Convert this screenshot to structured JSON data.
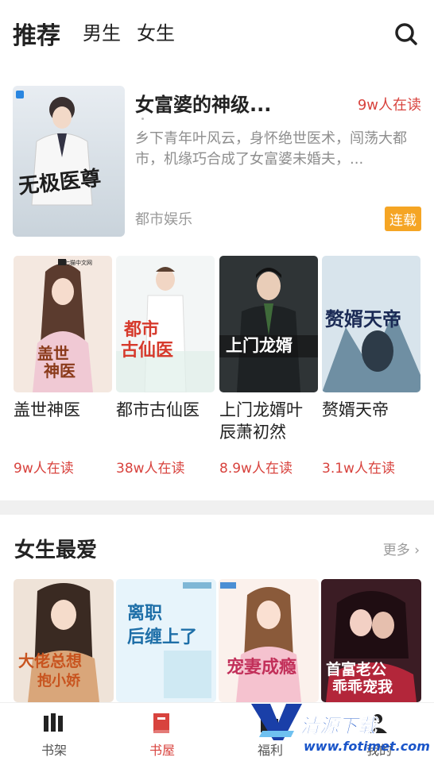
{
  "tabs": [
    {
      "label": "推荐",
      "active": true
    },
    {
      "label": "男生",
      "active": false
    },
    {
      "label": "女生",
      "active": false
    }
  ],
  "featured": {
    "title": "女富婆的神级...",
    "readers": "9w人在读",
    "description": "乡下青年叶风云，身怀绝世医术，闯荡大都市，机缘巧合成了女富婆未婚夫，...",
    "category": "都市娱乐",
    "status": "连载",
    "cover_text": "无极医尊"
  },
  "books": [
    {
      "title": "盖世神医",
      "readers": "9w人在读",
      "cover_text": "盖世神医",
      "publisher": "七猫中文网"
    },
    {
      "title": "都市古仙医",
      "readers": "38w人在读",
      "cover_text": "都市古仙医"
    },
    {
      "title": "上门龙婿叶辰萧初然",
      "readers": "8.9w人在读",
      "cover_text": "上门龙婿"
    },
    {
      "title": "赘婿天帝",
      "readers": "3.1w人在读",
      "cover_text": "赘婿天帝"
    }
  ],
  "section": {
    "title": "女生最爱",
    "more": "更多"
  },
  "girl_books": [
    {
      "cover_text": "大佬总想抱小娇"
    },
    {
      "cover_text": "离职后缠上了"
    },
    {
      "cover_text": "宠妻成瘾"
    },
    {
      "cover_text": "首富老公乖乖宠我"
    }
  ],
  "nav": [
    {
      "label": "书架",
      "active": false,
      "icon": "bookshelf-icon"
    },
    {
      "label": "书屋",
      "active": true,
      "icon": "bookstore-icon"
    },
    {
      "label": "福利",
      "active": false,
      "icon": "gift-icon"
    },
    {
      "label": "我的",
      "active": false,
      "icon": "profile-icon"
    }
  ],
  "watermark": {
    "name": "清源下载",
    "url": "www.fotimet.com"
  },
  "colors": {
    "accent": "#d8433e",
    "badge": "#f5a524"
  }
}
